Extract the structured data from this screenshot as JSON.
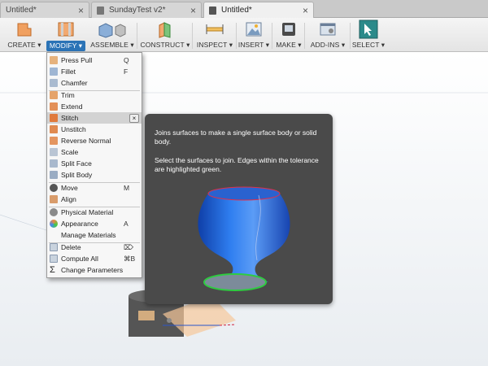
{
  "tabs": [
    {
      "label": "Untitled*",
      "close": "×"
    },
    {
      "label": "SundayTest v2*",
      "close": "×"
    },
    {
      "label": "Untitled*",
      "close": "×"
    }
  ],
  "toolbar": {
    "create": "CREATE ▾",
    "modify": "MODIFY ▾",
    "assemble": "ASSEMBLE ▾",
    "construct": "CONSTRUCT ▾",
    "inspect": "INSPECT ▾",
    "insert": "INSERT ▾",
    "make": "MAKE ▾",
    "addins": "ADD-INS ▾",
    "select": "SELECT ▾"
  },
  "menu": {
    "items": [
      {
        "label": "Press Pull",
        "shortcut": "Q",
        "icon": "press-pull-icon"
      },
      {
        "label": "Fillet",
        "shortcut": "F",
        "icon": "fillet-icon"
      },
      {
        "label": "Chamfer",
        "shortcut": "",
        "icon": "chamfer-icon"
      },
      {
        "label": "Trim",
        "shortcut": "",
        "icon": "trim-icon"
      },
      {
        "label": "Extend",
        "shortcut": "",
        "icon": "extend-icon"
      },
      {
        "label": "Stitch",
        "shortcut": "",
        "icon": "stitch-icon"
      },
      {
        "label": "Unstitch",
        "shortcut": "",
        "icon": "unstitch-icon"
      },
      {
        "label": "Reverse Normal",
        "shortcut": "",
        "icon": "reverse-normal-icon"
      },
      {
        "label": "Scale",
        "shortcut": "",
        "icon": "scale-icon"
      },
      {
        "label": "Split Face",
        "shortcut": "",
        "icon": "split-face-icon"
      },
      {
        "label": "Split Body",
        "shortcut": "",
        "icon": "split-body-icon"
      },
      {
        "label": "Move",
        "shortcut": "M",
        "icon": "move-icon"
      },
      {
        "label": "Align",
        "shortcut": "",
        "icon": "align-icon"
      },
      {
        "label": "Physical Material",
        "shortcut": "",
        "icon": "physical-material-icon"
      },
      {
        "label": "Appearance",
        "shortcut": "A",
        "icon": "appearance-icon"
      },
      {
        "label": "Manage Materials",
        "shortcut": "",
        "icon": "manage-materials-icon"
      },
      {
        "label": "Delete",
        "shortcut": "⌦",
        "icon": "delete-icon"
      },
      {
        "label": "Compute All",
        "shortcut": "⌘B",
        "icon": "compute-all-icon"
      },
      {
        "label": "Change Parameters",
        "shortcut": "",
        "icon": "change-parameters-icon"
      }
    ],
    "highlighted": "Stitch",
    "pin": "×"
  },
  "tooltip": {
    "line1": "Joins surfaces to make a single surface body or solid body.",
    "line2": "Select the surfaces to join. Edges within the tolerance are highlighted green."
  },
  "colors": {
    "accent": "#2b73b6",
    "tooltip_bg": "#4a4a4a",
    "body_blue": "#1f6ae0",
    "edge_green": "#2ecc40",
    "edge_red": "#e0304a"
  }
}
